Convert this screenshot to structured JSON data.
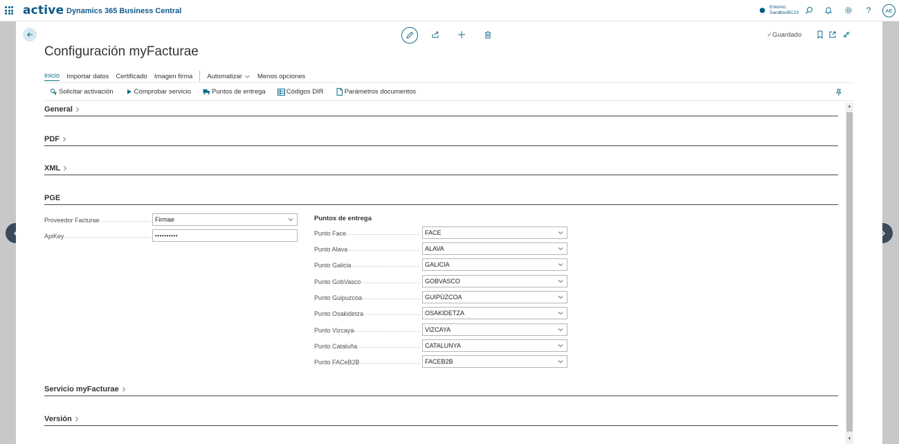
{
  "topbar": {
    "logo": "active",
    "app_name": "Dynamics 365 Business Central",
    "env_label": "Entorno:",
    "env_name": "SandboxBC23",
    "avatar_initials": "AE"
  },
  "page": {
    "title": "Configuración myFacturae",
    "status": "Guardado"
  },
  "tabs": [
    {
      "label": "Inicio"
    },
    {
      "label": "Importar datos"
    },
    {
      "label": "Certificado"
    },
    {
      "label": "Imagen firma"
    },
    {
      "label": "Automatizar"
    },
    {
      "label": "Menos opciones"
    }
  ],
  "actions": [
    {
      "label": "Solicitar activación",
      "icon": "activation-icon"
    },
    {
      "label": "Comprobar servicio",
      "icon": "play-icon"
    },
    {
      "label": "Puntos de entrega",
      "icon": "truck-icon"
    },
    {
      "label": "Códigos DIR",
      "icon": "table-icon"
    },
    {
      "label": "Parámetros documentos",
      "icon": "document-icon"
    }
  ],
  "fasttabs": {
    "general": "General",
    "pdf": "PDF",
    "xml": "XML",
    "pge": "PGE",
    "servicio": "Servicio myFacturae",
    "version": "Versión"
  },
  "pge": {
    "proveedor_label": "Proveedor Facturae",
    "proveedor_value": "Firmae",
    "apikey_label": "ApiKey",
    "apikey_value": "••••••••••",
    "puntos_title": "Puntos de entrega",
    "puntos": [
      {
        "label": "Punto Face",
        "value": "FACE"
      },
      {
        "label": "Punto Alava",
        "value": "ALAVA"
      },
      {
        "label": "Punto Galicia",
        "value": "GALICIA"
      },
      {
        "label": "Punto GobVasco",
        "value": "GOBVASCO"
      },
      {
        "label": "Punto Guipuzcoa",
        "value": "GUIPÚZCOA"
      },
      {
        "label": "Punto Osakidetza",
        "value": "OSAKIDETZA"
      },
      {
        "label": "Punto Vizcaya",
        "value": "VIZCAYA"
      },
      {
        "label": "Punto Cataluña",
        "value": "CATALUNYA"
      },
      {
        "label": "Punto FACeB2B",
        "value": "FACEB2B"
      }
    ]
  }
}
